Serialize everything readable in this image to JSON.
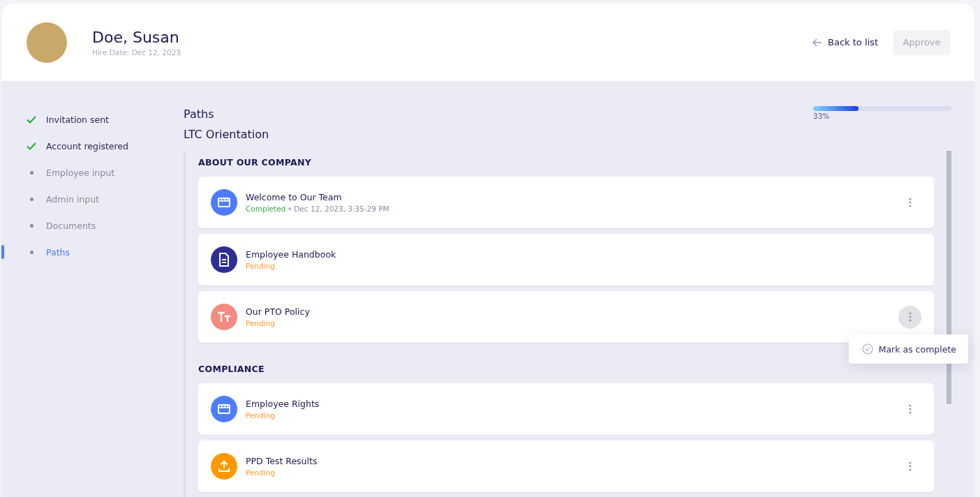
{
  "header": {
    "name": "Doe, Susan",
    "hire_date": "Hire Date: Dec 12, 2023",
    "back_link": "Back to list",
    "approve_button": {
      "label": "Approve",
      "disabled": true
    }
  },
  "steps": [
    {
      "label": "Invitation sent",
      "done": true,
      "selected": false
    },
    {
      "label": "Account registered",
      "done": true,
      "selected": false
    },
    {
      "label": "Employee input",
      "done": false,
      "selected": false
    },
    {
      "label": "Admin input",
      "done": false,
      "selected": false
    },
    {
      "label": "Documents",
      "done": false,
      "selected": false
    },
    {
      "label": "Paths",
      "done": false,
      "selected": true
    }
  ],
  "paths": {
    "title": "Paths",
    "progress": {
      "level": 0.33,
      "reading": "33%"
    },
    "path_name": "LTC Orientation",
    "sections": [
      {
        "title": "ABOUT OUR COMPANY",
        "items": [
          {
            "kind": "video",
            "color": "#4f7cff",
            "title": "Welcome to Our Team",
            "status": {
              "label": "Completed",
              "color": "#3aab4a"
            },
            "date": "Dec 12, 2023, 3:35:29 PM",
            "has_menu": true,
            "menu_open": false
          },
          {
            "kind": "document",
            "color": "#2e2f94",
            "title": "Employee Handbook",
            "status": {
              "label": "Pending",
              "color": "#ff9a2e"
            },
            "has_menu": false,
            "menu_open": false
          },
          {
            "kind": "text",
            "color": "#f48a80",
            "title": "Our PTO Policy",
            "status": {
              "label": "Pending",
              "color": "#ff9a2e"
            },
            "has_menu": true,
            "menu_open": true
          }
        ]
      },
      {
        "title": "COMPLIANCE",
        "items": [
          {
            "kind": "video",
            "color": "#4f7cff",
            "title": "Employee Rights",
            "status": {
              "label": "Pending",
              "color": "#ff9a2e"
            },
            "has_menu": true,
            "menu_open": false
          },
          {
            "kind": "upload",
            "color": "#ff9800",
            "title": "PPD Test Results",
            "status": {
              "label": "Pending",
              "color": "#ff9a2e"
            },
            "has_menu": true,
            "menu_open": false
          }
        ]
      }
    ],
    "menu": {
      "items": [
        "Mark as complete"
      ]
    }
  }
}
